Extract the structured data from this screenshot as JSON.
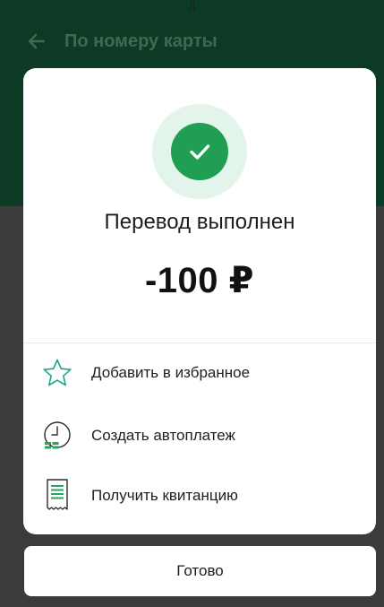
{
  "status_bar": {
    "fragment": "Д"
  },
  "app_bar": {
    "title": "По номеру карты",
    "back_icon": "arrow-left-icon"
  },
  "dialog": {
    "status_icon": "check-circle-icon",
    "title": "Перевод выполнен",
    "amount": "-100 ₽",
    "actions": [
      {
        "label": "Добавить в избранное",
        "icon": "star-icon"
      },
      {
        "label": "Создать автоплатеж",
        "icon": "clock-autopay-icon"
      },
      {
        "label": "Получить квитанцию",
        "icon": "receipt-icon"
      }
    ]
  },
  "footer": {
    "done_label": "Готово"
  },
  "colors": {
    "brand_dark": "#0c3a24",
    "success_green": "#1f9e54",
    "success_bg": "#e3f4ea",
    "icon_teal": "#21a38a"
  }
}
